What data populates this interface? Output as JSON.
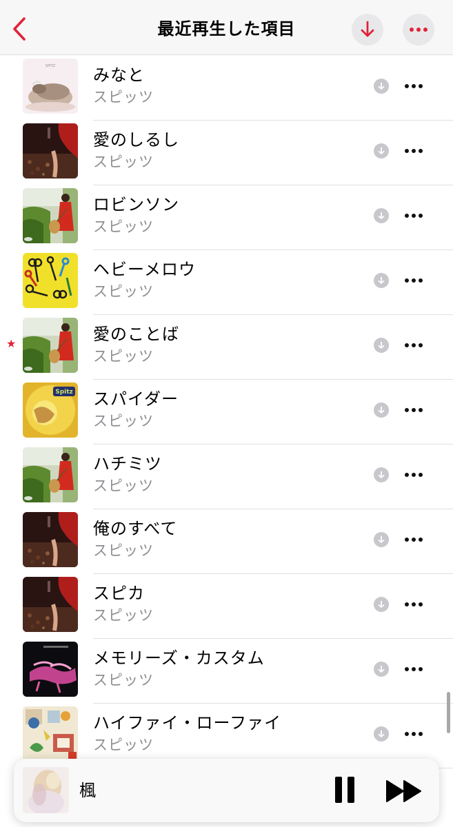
{
  "header": {
    "title": "最近再生した項目",
    "accent_color": "#e0233a"
  },
  "songs": [
    {
      "title": "みなと",
      "artist": "スピッツ",
      "art": "cow",
      "favorite": false
    },
    {
      "title": "愛のしるし",
      "artist": "スピッツ",
      "art": "dark-red",
      "favorite": false
    },
    {
      "title": "ロビンソン",
      "artist": "スピッツ",
      "art": "guitar-girl",
      "favorite": false
    },
    {
      "title": "ヘビーメロウ",
      "artist": "スピッツ",
      "art": "scissors",
      "favorite": false
    },
    {
      "title": "愛のことば",
      "artist": "スピッツ",
      "art": "guitar-girl",
      "favorite": true
    },
    {
      "title": "スパイダー",
      "artist": "スピッツ",
      "art": "yellow-spitz",
      "favorite": false
    },
    {
      "title": "ハチミツ",
      "artist": "スピッツ",
      "art": "guitar-girl",
      "favorite": false
    },
    {
      "title": "俺のすべて",
      "artist": "スピッツ",
      "art": "dark-red",
      "favorite": false
    },
    {
      "title": "スピカ",
      "artist": "スピッツ",
      "art": "dark-red",
      "favorite": false
    },
    {
      "title": "メモリーズ・カスタム",
      "artist": "スピッツ",
      "art": "pink-dancers",
      "favorite": false
    },
    {
      "title": "ハイファイ・ローファイ",
      "artist": "スピッツ",
      "art": "collage",
      "favorite": false
    }
  ],
  "album_text": {
    "minato": "SPITZ",
    "spider": "Spitz"
  },
  "now_playing": {
    "title": "楓",
    "art": "soft-blonde"
  },
  "icons": {
    "back": "chevron-left-icon",
    "download": "download-arrow-icon",
    "more": "ellipsis-icon",
    "pause": "pause-icon",
    "forward": "fast-forward-icon",
    "favorite": "star-icon"
  }
}
